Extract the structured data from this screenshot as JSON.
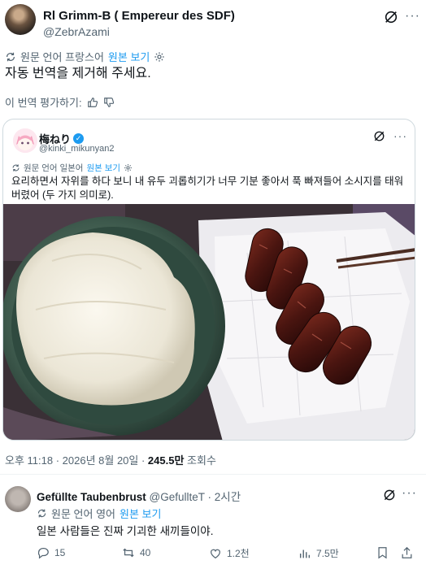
{
  "author": {
    "name": "Rl Grimm-B ( Empereur des SDF)",
    "handle": "@ZebrAzami"
  },
  "translation": {
    "source_label": "원문 언어 프랑스어",
    "show_original": "원본 보기"
  },
  "post_text": "자동 번역을 제거해 주세요.",
  "rate_translation": "이 번역 평가하기:",
  "quote": {
    "name": "梅ねり",
    "handle": "@kinki_mikunyan2",
    "source_label": "원문 언어 일본어",
    "show_original": "원본 보기",
    "text": "요리하면서 자위를 하다 보니 내 유두 괴롭히기가 너무 기분 좋아서 푹 빠져들어 소시지를 태워버렸어 (두 가지 의미로)."
  },
  "meta": {
    "time_date": "오후 11:18 · 2026년 8월 20일 · ",
    "views": "245.5만",
    "views_label": " 조회수"
  },
  "reply": {
    "name": "Gefüllte Taubenbrust",
    "handle": "@GefullteT",
    "time": "· 2시간",
    "source_label": "원문 언어 영어",
    "show_original": "원본 보기",
    "text": "일본 사람들은 진짜 기괴한 새끼들이야.",
    "replies": "15",
    "reposts": "40",
    "likes": "1.2천",
    "views": "7.5만"
  },
  "colors": {
    "accent": "#1d9bf0",
    "secondary_text": "#536471",
    "border": "#cfd9de"
  },
  "icons": [
    "grok-icon",
    "more-icon",
    "translate-icon",
    "gear-icon",
    "thumbs-up-icon",
    "thumbs-down-icon",
    "verified-icon",
    "reply-icon",
    "repost-icon",
    "like-icon",
    "views-icon",
    "bookmark-icon",
    "share-icon"
  ]
}
